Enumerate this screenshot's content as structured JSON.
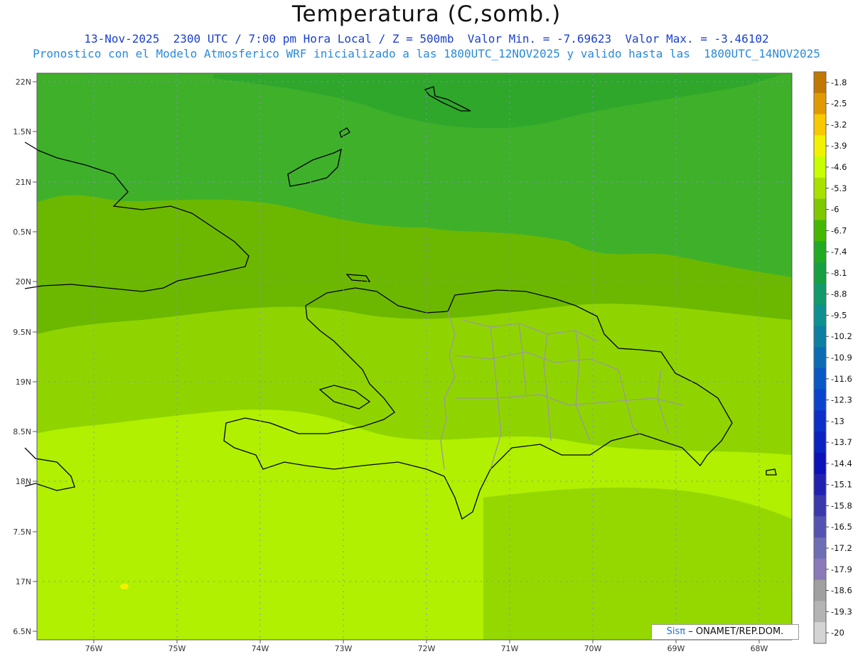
{
  "title": "Temperatura (C,somb.)",
  "subtitle1": "13-Nov-2025  2300 UTC / 7:00 pm Hora Local / Z = 500mb  Valor Min. = -7.69623  Valor Max. = -3.46102",
  "subtitle2": "Pronostico con el Modelo Atmosferico WRF inicializado a las 1800UTC_12NOV2025 y valido hasta las  1800UTC_14NOV2025",
  "lat_labels": [
    "22N",
    "1.5N",
    "21N",
    "0.5N",
    "20N",
    "9.5N",
    "19N",
    "8.5N",
    "18N",
    "7.5N",
    "17N",
    "6.5N"
  ],
  "lon_labels": [
    "76W",
    "75W",
    "74W",
    "73W",
    "72W",
    "71W",
    "70W",
    "69W",
    "68W"
  ],
  "colorbar": {
    "labels": [
      "-1.8",
      "-2.5",
      "-3.2",
      "-3.9",
      "-4.6",
      "-5.3",
      "-6",
      "-6.7",
      "-7.4",
      "-8.1",
      "-8.8",
      "-9.5",
      "-10.2",
      "-10.9",
      "-11.6",
      "-12.3",
      "-13",
      "-13.7",
      "-14.4",
      "-15.1",
      "-15.8",
      "-16.5",
      "-17.2",
      "-17.9",
      "-18.6",
      "-19.3",
      "-20"
    ],
    "colors": [
      "#c07800",
      "#e09a00",
      "#f8c800",
      "#f2f200",
      "#c8ff00",
      "#a8e000",
      "#7ec800",
      "#44b800",
      "#22aa22",
      "#16a040",
      "#129a6a",
      "#0f9090",
      "#0d7fa0",
      "#0b6cb4",
      "#0a58c4",
      "#0a44cc",
      "#0a30c8",
      "#0a22c0",
      "#0a12b8",
      "#2222b0",
      "#3a3aac",
      "#5454b0",
      "#6e6eb4",
      "#8a7ab8",
      "#a0a0a0",
      "#b4b4b4",
      "#d4d4d4"
    ]
  },
  "credit": {
    "brand": "Sisπ",
    "text": "– ONAMET/REP.DOM."
  },
  "map_colors": {
    "north_dark": "#33b02c",
    "mid_green": "#6cb800",
    "light_green": "#9be000",
    "south_bright": "#b0f000",
    "coast": "#000000",
    "provinces": "#9a9a9a",
    "grid": "#8a8ad8"
  }
}
